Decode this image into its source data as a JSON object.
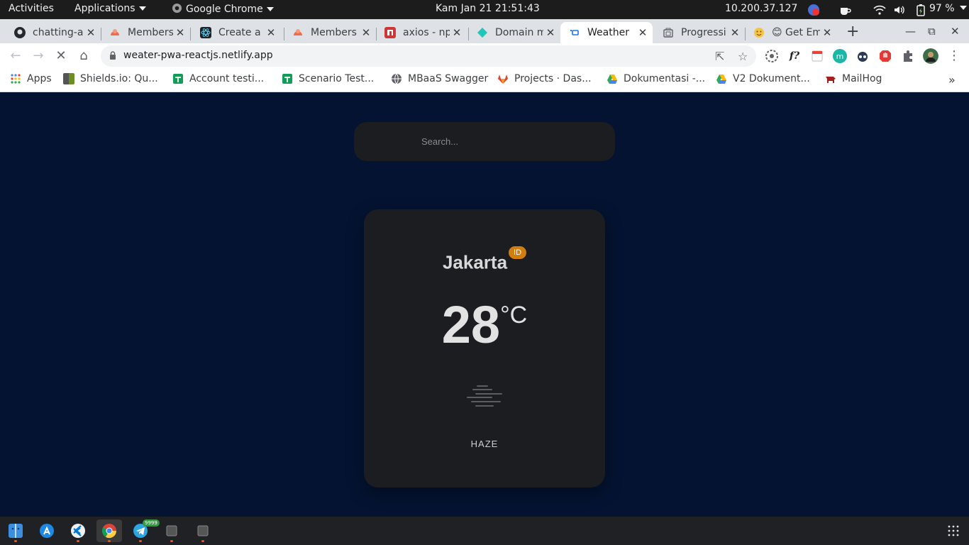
{
  "topbar": {
    "activities": "Activities",
    "applications": "Applications",
    "app_name": "Google Chrome",
    "datetime": "Kam Jan 21  21:51:43",
    "ip": "10.200.37.127",
    "battery": "97 %"
  },
  "tabs": [
    {
      "label": "chatting-a",
      "icon": "github-icon",
      "color": "#24292e"
    },
    {
      "label": "Members",
      "icon": "members-icon",
      "color": "#ef6c4a"
    },
    {
      "label": "Create a N",
      "icon": "react-icon",
      "color": "#20232a"
    },
    {
      "label": "Members",
      "icon": "members-icon",
      "color": "#ef6c4a"
    },
    {
      "label": "axios - np",
      "icon": "npm-icon",
      "color": "#cb3837"
    },
    {
      "label": "Domain m",
      "icon": "netlify-icon",
      "color": "#20c6b7"
    },
    {
      "label": "Weather",
      "icon": "weather-icon",
      "color": "#1a73e8"
    },
    {
      "label": "Progressi",
      "icon": "pwa-icon",
      "color": "#5f6368"
    },
    {
      "label": "😊 Get Em",
      "icon": "emoji-icon",
      "color": "#f5c542"
    }
  ],
  "address": {
    "url": "weater-pwa-reactjs.netlify.app"
  },
  "bookmarks": [
    {
      "label": "Apps",
      "icon": "apps-grid-icon",
      "color": "#4285f4"
    },
    {
      "label": "Shields.io: Qu...",
      "icon": "shields-icon",
      "color": "#6b8e23"
    },
    {
      "label": "Account testi...",
      "icon": "sheets-icon",
      "color": "#0f9d58"
    },
    {
      "label": "Scenario Test...",
      "icon": "sheets-icon",
      "color": "#0f9d58"
    },
    {
      "label": "MBaaS Swagger",
      "icon": "globe-icon",
      "color": "#5f6368"
    },
    {
      "label": "Projects · Das...",
      "icon": "gitlab-icon",
      "color": "#e24329"
    },
    {
      "label": "Dokumentasi -...",
      "icon": "drive-icon",
      "color": "#fbbc04"
    },
    {
      "label": "V2 Dokument...",
      "icon": "drive-icon",
      "color": "#fbbc04"
    },
    {
      "label": "MailHog",
      "icon": "mailhog-icon",
      "color": "#a61d1d"
    }
  ],
  "weather": {
    "search_placeholder": "Search...",
    "city": "Jakarta",
    "country": "ID",
    "temp": "28",
    "unit": "°C",
    "condition": "HAZE"
  },
  "colors": {
    "page_bg": "#041331",
    "card_bg": "#1c1d20",
    "badge": "#d27d10"
  }
}
